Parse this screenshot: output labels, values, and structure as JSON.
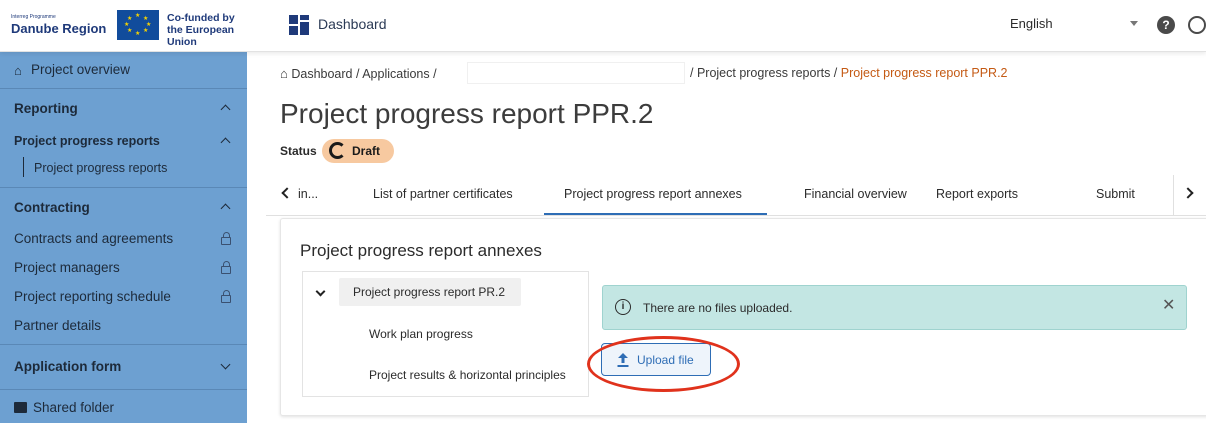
{
  "header": {
    "logo_small": "Interreg Programme",
    "logo_main": "Danube Region",
    "cofunded_line1": "Co-funded by",
    "cofunded_line2": "the European Union",
    "dashboard_label": "Dashboard",
    "language": "English"
  },
  "sidebar": {
    "project_overview": "Project overview",
    "reporting": "Reporting",
    "project_progress_reports": "Project progress reports",
    "project_progress_reports_sub": "Project progress reports",
    "contracting": "Contracting",
    "contracts_and_agreements": "Contracts and agreements",
    "project_managers": "Project managers",
    "project_reporting_schedule": "Project reporting schedule",
    "partner_details": "Partner details",
    "application_form": "Application form",
    "shared_folder": "Shared folder"
  },
  "breadcrumb": {
    "part1": "Dashboard / Applications /",
    "part2": "/ Project progress reports /",
    "current": "Project progress report PPR.2"
  },
  "page": {
    "title": "Project progress report PPR.2",
    "status_label": "Status",
    "status_value": "Draft"
  },
  "tabs": [
    {
      "label": "in..."
    },
    {
      "label": "List of partner certificates"
    },
    {
      "label": "Project progress report annexes"
    },
    {
      "label": "Financial overview"
    },
    {
      "label": "Report exports"
    },
    {
      "label": "Submit"
    }
  ],
  "annexes": {
    "title": "Project progress report annexes",
    "tree_root": "Project progress report PR.2",
    "tree_items": [
      "Work plan progress",
      "Project results & horizontal principles"
    ],
    "alert_text": "There are no files uploaded.",
    "upload_label": "Upload file"
  },
  "colors": {
    "sidebar": "#6da0d1",
    "accent": "#2e6db5",
    "breadcrumb_current": "#c45a14",
    "draft_badge": "#f7c9a0",
    "alert_bg": "#c3e6e3",
    "highlight": "#e0321c"
  }
}
